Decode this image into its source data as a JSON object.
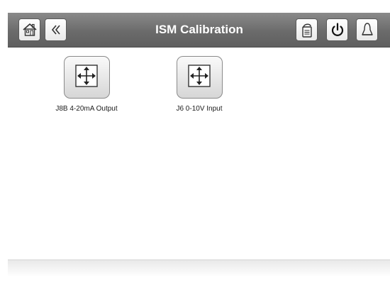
{
  "header": {
    "title": "ISM Calibration",
    "home_icon": "home-icon",
    "back_icon": "back-chevron-icon",
    "login_icon": "door-hanger-icon",
    "power_icon": "power-icon",
    "alarm_icon": "bell-icon"
  },
  "items": [
    {
      "label": "J8B 4-20mA Output",
      "icon": "calibration-arrows-icon"
    },
    {
      "label": "J6 0-10V Input",
      "icon": "calibration-arrows-icon"
    }
  ]
}
